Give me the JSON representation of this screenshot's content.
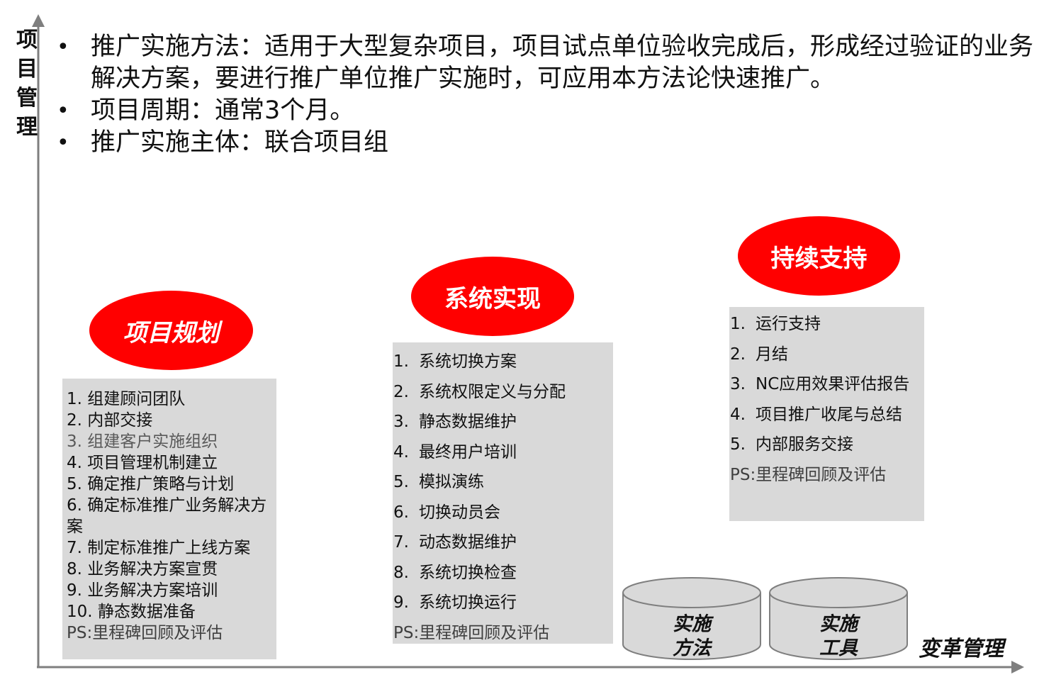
{
  "axes": {
    "y_label_chars": [
      "项",
      "目",
      "管",
      "理"
    ],
    "x_label": "变革管理"
  },
  "bullets": [
    "推广实施方法：适用于大型复杂项目，项目试点单位验收完成后，形成经过验证的业务解决方案，要进行推广单位推广实施时，可应用本方法论快速推广。",
    "项目周期：通常3个月。",
    "推广实施主体：联合项目组"
  ],
  "phases": [
    {
      "title": "项目规划",
      "items": [
        {
          "num": "1.",
          "text": "组建顾问团队"
        },
        {
          "num": "2.",
          "text": "内部交接"
        },
        {
          "num": "3.",
          "text": "组建客户实施组织"
        },
        {
          "num": "4.",
          "text": "项目管理机制建立"
        },
        {
          "num": "5.",
          "text": "确定推广策略与计划"
        },
        {
          "num": "6.",
          "text": "确定标准推广业务解决方案"
        },
        {
          "num": "7.",
          "text": "制定标准推广上线方案"
        },
        {
          "num": "8.",
          "text": "业务解决方案宣贯"
        },
        {
          "num": "9.",
          "text": "业务解决方案培训"
        },
        {
          "num": "10.",
          "text": "静态数据准备"
        }
      ],
      "ps": "PS:里程碑回顾及评估"
    },
    {
      "title": "系统实现",
      "items": [
        {
          "num": "1.",
          "text": "系统切换方案"
        },
        {
          "num": "2.",
          "text": "系统权限定义与分配"
        },
        {
          "num": "3.",
          "text": "静态数据维护"
        },
        {
          "num": "4.",
          "text": "最终用户培训"
        },
        {
          "num": "5.",
          "text": "模拟演练"
        },
        {
          "num": "6.",
          "text": "切换动员会"
        },
        {
          "num": "7.",
          "text": "动态数据维护"
        },
        {
          "num": "8.",
          "text": "系统切换检查"
        },
        {
          "num": "9.",
          "text": "系统切换运行"
        }
      ],
      "ps": "PS:里程碑回顾及评估"
    },
    {
      "title": "持续支持",
      "items": [
        {
          "num": "1.",
          "text": "运行支持"
        },
        {
          "num": "2.",
          "text": "月结"
        },
        {
          "num": "3.",
          "text": "NC应用效果评估报告"
        },
        {
          "num": "4.",
          "text": "项目推广收尾与总结"
        },
        {
          "num": "5.",
          "text": "内部服务交接"
        }
      ],
      "ps": "PS:里程碑回顾及评估"
    }
  ],
  "cylinders": [
    {
      "line1": "实施",
      "line2": "方法"
    },
    {
      "line1": "实施",
      "line2": "工具"
    }
  ],
  "colors": {
    "oval_fill": "#ff0000",
    "box_fill": "#d9d9d9",
    "cylinder_fill": "#d9d9d9",
    "axis": "#7f7f7f",
    "ps_text": "#404040",
    "muted_text": "#595959"
  }
}
